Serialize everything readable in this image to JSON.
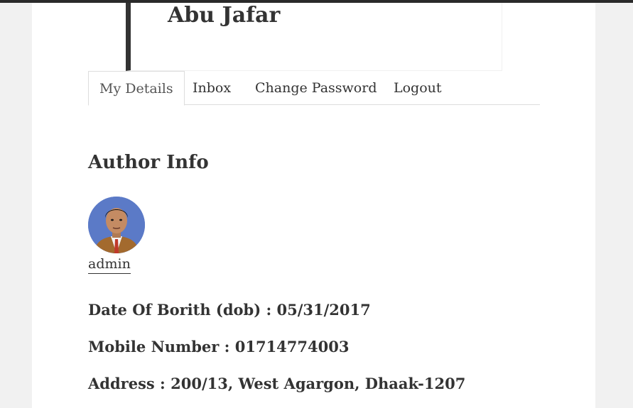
{
  "site": {
    "title": "Abu Jafar"
  },
  "tabs": [
    {
      "label": "My Details",
      "active": true
    },
    {
      "label": "Inbox",
      "active": false
    },
    {
      "label": "Change Password",
      "active": false
    },
    {
      "label": "Logout",
      "active": false
    }
  ],
  "author": {
    "section_title": "Author Info",
    "username": "admin",
    "avatar_icon": "user-avatar-photo",
    "dob_line": "Date Of Borith (dob) : 05/31/2017",
    "mobile_line": "Mobile Number : 01714774003",
    "address_line": "Address : 200/13, West Agargon, Dhaak-1207"
  },
  "colors": {
    "text": "#333333",
    "page_background": "#f1f1f1",
    "content_background": "#ffffff",
    "avatar_background": "#5b7ac7",
    "border": "#dddddd"
  }
}
